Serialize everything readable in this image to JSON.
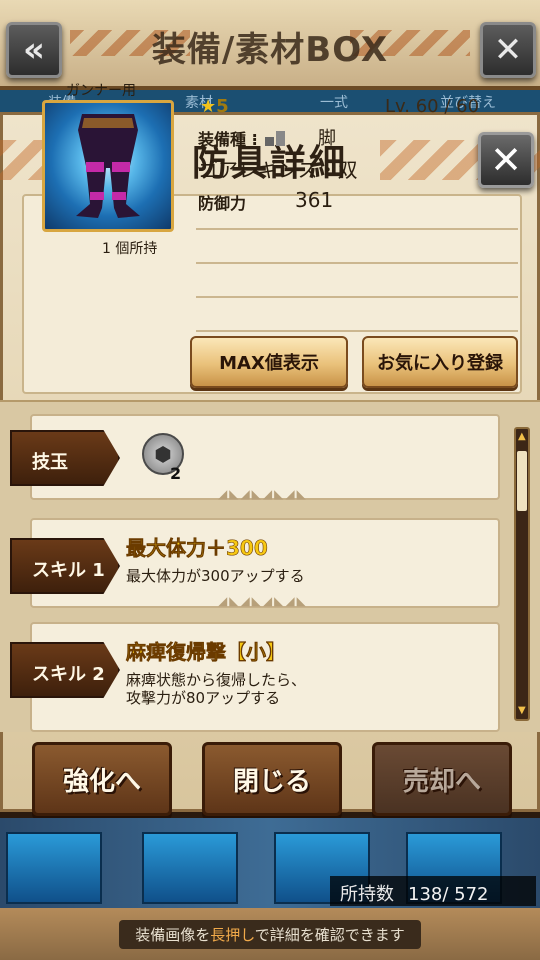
{
  "header": {
    "title": "装備/素材BOX",
    "back_icon": "back-arrow-icon",
    "close_icon": "close-icon"
  },
  "tabs": [
    "装備",
    "素材",
    "一式",
    "並び替え"
  ],
  "dialog": {
    "title": "防具詳細",
    "close_icon": "close-icon",
    "armor": {
      "usage": "ガンナー用",
      "image_icon": "armor-legs-icon",
      "owned": "1 個所持",
      "rarity_star": "★",
      "rarity": "5",
      "level": "Lv. 60 / 60",
      "type_label": "装備種",
      "type_value": "脚",
      "name": "ゴアレギンス・双",
      "defense_label": "防御力",
      "defense_value": "361"
    },
    "buttons": {
      "max": "MAX値表示",
      "favorite": "お気に入り登録"
    },
    "slots": {
      "label": "技玉",
      "gem_icon": "skill-gem-icon",
      "count": "2"
    },
    "skills": [
      {
        "tag": "スキル 1",
        "name": "最大体力＋300",
        "desc": "最大体力が300アップする"
      },
      {
        "tag": "スキル 2",
        "name": "麻痺復帰撃【小】",
        "desc1": "麻痺状態から復帰したら、",
        "desc2": "攻撃力が80アップする"
      }
    ]
  },
  "actions": {
    "enhance": "強化へ",
    "close": "閉じる",
    "sell": "売却へ"
  },
  "inventory": {
    "label": "所持数",
    "value": "138/ 572"
  },
  "footer": {
    "hint_pre": "装備画像を",
    "hint_hl": "長押し",
    "hint_post": "で詳細を確認できます"
  }
}
